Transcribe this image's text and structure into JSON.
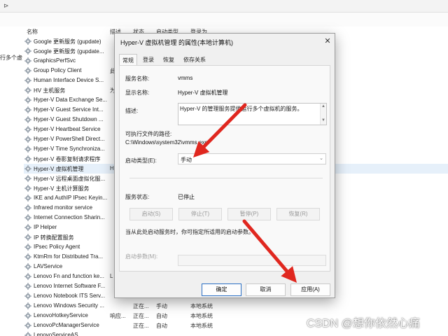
{
  "window": {
    "columns": {
      "name": "名称",
      "description": "描述",
      "status": "状态",
      "startup": "启动类型",
      "logon": "登录为"
    },
    "left_pane_text": "行多个虚"
  },
  "services": [
    {
      "name": "Google 更新服务 (gupdate)",
      "desc": "",
      "status": "",
      "startup": "",
      "logon": ""
    },
    {
      "name": "Google 更新服务 (gupdate...",
      "desc": "",
      "status": "",
      "startup": "",
      "logon": ""
    },
    {
      "name": "GraphicsPerfSvc",
      "desc": "",
      "status": "",
      "startup": "",
      "logon": ""
    },
    {
      "name": "Group Policy Client",
      "desc": "此",
      "status": "",
      "startup": "",
      "logon": ""
    },
    {
      "name": "Human Interface Device S...",
      "desc": "",
      "status": "",
      "startup": "",
      "logon": ""
    },
    {
      "name": "HV 主机服务",
      "desc": "为",
      "status": "",
      "startup": "",
      "logon": ""
    },
    {
      "name": "Hyper-V Data Exchange Se...",
      "desc": "",
      "status": "",
      "startup": "",
      "logon": ""
    },
    {
      "name": "Hyper-V Guest Service Int...",
      "desc": "",
      "status": "",
      "startup": "",
      "logon": ""
    },
    {
      "name": "Hyper-V Guest Shutdown ...",
      "desc": "",
      "status": "",
      "startup": "",
      "logon": ""
    },
    {
      "name": "Hyper-V Heartbeat Service",
      "desc": "",
      "status": "",
      "startup": "",
      "logon": ""
    },
    {
      "name": "Hyper-V PowerShell Direct...",
      "desc": "",
      "status": "",
      "startup": "",
      "logon": ""
    },
    {
      "name": "Hyper-V Time Synchroniza...",
      "desc": "",
      "status": "",
      "startup": "",
      "logon": ""
    },
    {
      "name": "Hyper-V 卷影复制请求程序",
      "desc": "",
      "status": "",
      "startup": "",
      "logon": ""
    },
    {
      "name": "Hyper-V 虚拟机管理",
      "desc": "H",
      "status": "",
      "startup": "",
      "logon": "",
      "selected": true
    },
    {
      "name": "Hyper-V 远程桌面虚拟化服...",
      "desc": "",
      "status": "",
      "startup": "",
      "logon": ""
    },
    {
      "name": "Hyper-V 主机计算服务",
      "desc": "",
      "status": "",
      "startup": "",
      "logon": ""
    },
    {
      "name": "IKE and AuthIP IPsec Keyin...",
      "desc": "",
      "status": "",
      "startup": "",
      "logon": ""
    },
    {
      "name": "Infrared monitor service",
      "desc": "",
      "status": "",
      "startup": "",
      "logon": ""
    },
    {
      "name": "Internet Connection Sharin...",
      "desc": "",
      "status": "",
      "startup": "",
      "logon": ""
    },
    {
      "name": "IP Helper",
      "desc": "",
      "status": "",
      "startup": "",
      "logon": ""
    },
    {
      "name": "IP 转换配置服务",
      "desc": "",
      "status": "",
      "startup": "",
      "logon": ""
    },
    {
      "name": "IPsec Policy Agent",
      "desc": "",
      "status": "",
      "startup": "",
      "logon": ""
    },
    {
      "name": "KtmRm for Distributed Tra...",
      "desc": "",
      "status": "",
      "startup": "",
      "logon": ""
    },
    {
      "name": "LAVService",
      "desc": "",
      "status": "",
      "startup": "",
      "logon": ""
    },
    {
      "name": "Lenovo Fn and function ke...",
      "desc": "L",
      "status": "",
      "startup": "",
      "logon": ""
    },
    {
      "name": "Lenovo Internet Software F...",
      "desc": "",
      "status": "",
      "startup": "",
      "logon": ""
    },
    {
      "name": "Lenovo Notebook ITS Serv...",
      "desc": "",
      "status": "",
      "startup": "",
      "logon": ""
    },
    {
      "name": "Lenovo Windows Security ...",
      "desc": "",
      "status": "正在...",
      "startup": "手动",
      "logon": "本地系统"
    },
    {
      "name": "LenovoHotkeyService",
      "desc": "响应...",
      "status": "正在...",
      "startup": "自动",
      "logon": "本地系统"
    },
    {
      "name": "LenovoPcManagerService",
      "desc": "",
      "status": "正在...",
      "startup": "自动",
      "logon": "本地系统"
    },
    {
      "name": "LenovoServiceAS",
      "desc": "",
      "status": "",
      "startup": "",
      "logon": ""
    }
  ],
  "dialog": {
    "title": "Hyper-V 虚拟机管理 的属性(本地计算机)",
    "close_glyph": "✕",
    "tabs": [
      "常规",
      "登录",
      "恢复",
      "依存关系"
    ],
    "service_name_label": "服务名称:",
    "service_name_value": "vmms",
    "display_name_label": "显示名称:",
    "display_name_value": "Hyper-V 虚拟机管理",
    "description_label": "描述:",
    "description_value": "Hyper-V 的管理服务提供运行多个虚拟机的服务。",
    "path_label": "可执行文件的路径:",
    "path_value": "C:\\Windows\\system32\\vmms.exe",
    "startup_type_label": "启动类型(E):",
    "startup_type_value": "手动",
    "service_status_label": "服务状态:",
    "service_status_value": "已停止",
    "buttons": {
      "start": "启动(S)",
      "stop": "停止(T)",
      "pause": "暂停(P)",
      "resume": "恢复(R)"
    },
    "hint_text": "当从此处启动服务时，你可指定所适用的启动参数。",
    "start_params_label": "启动参数(M):",
    "ok_label": "确定",
    "cancel_label": "取消",
    "apply_label": "应用(A)"
  },
  "annotation_color": "#e0271f",
  "watermark": "CSDN @想你依然心痛"
}
